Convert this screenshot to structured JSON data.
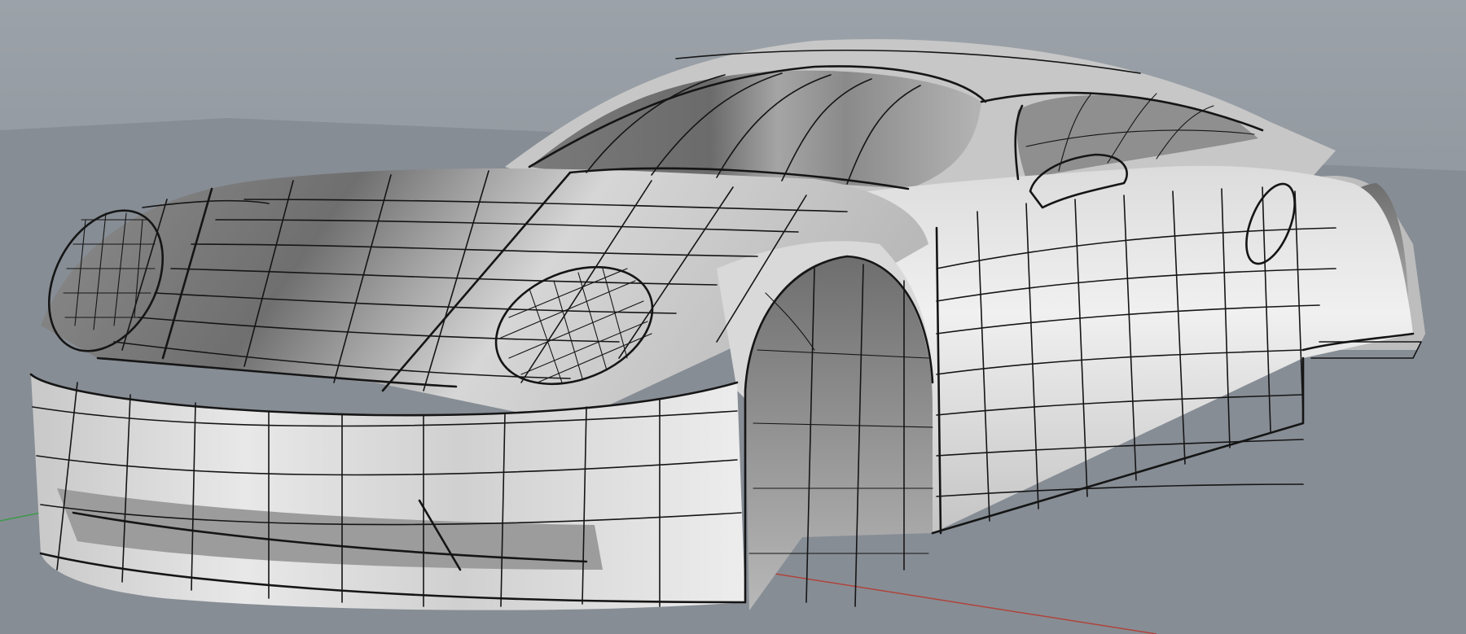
{
  "viewport": {
    "background_top": "#9aa0a7",
    "background_floor": "#858b93",
    "grid_color": "#7f858d"
  },
  "axes": {
    "x_axis_color": "#b0433a",
    "y_axis_color": "#3c9a49"
  },
  "model": {
    "shading": "shaded-with-isocurves",
    "surface_light": "#ececec",
    "surface_mid": "#c9c9c9",
    "surface_dark": "#7c7c7c",
    "isocurve_color": "#151515"
  }
}
